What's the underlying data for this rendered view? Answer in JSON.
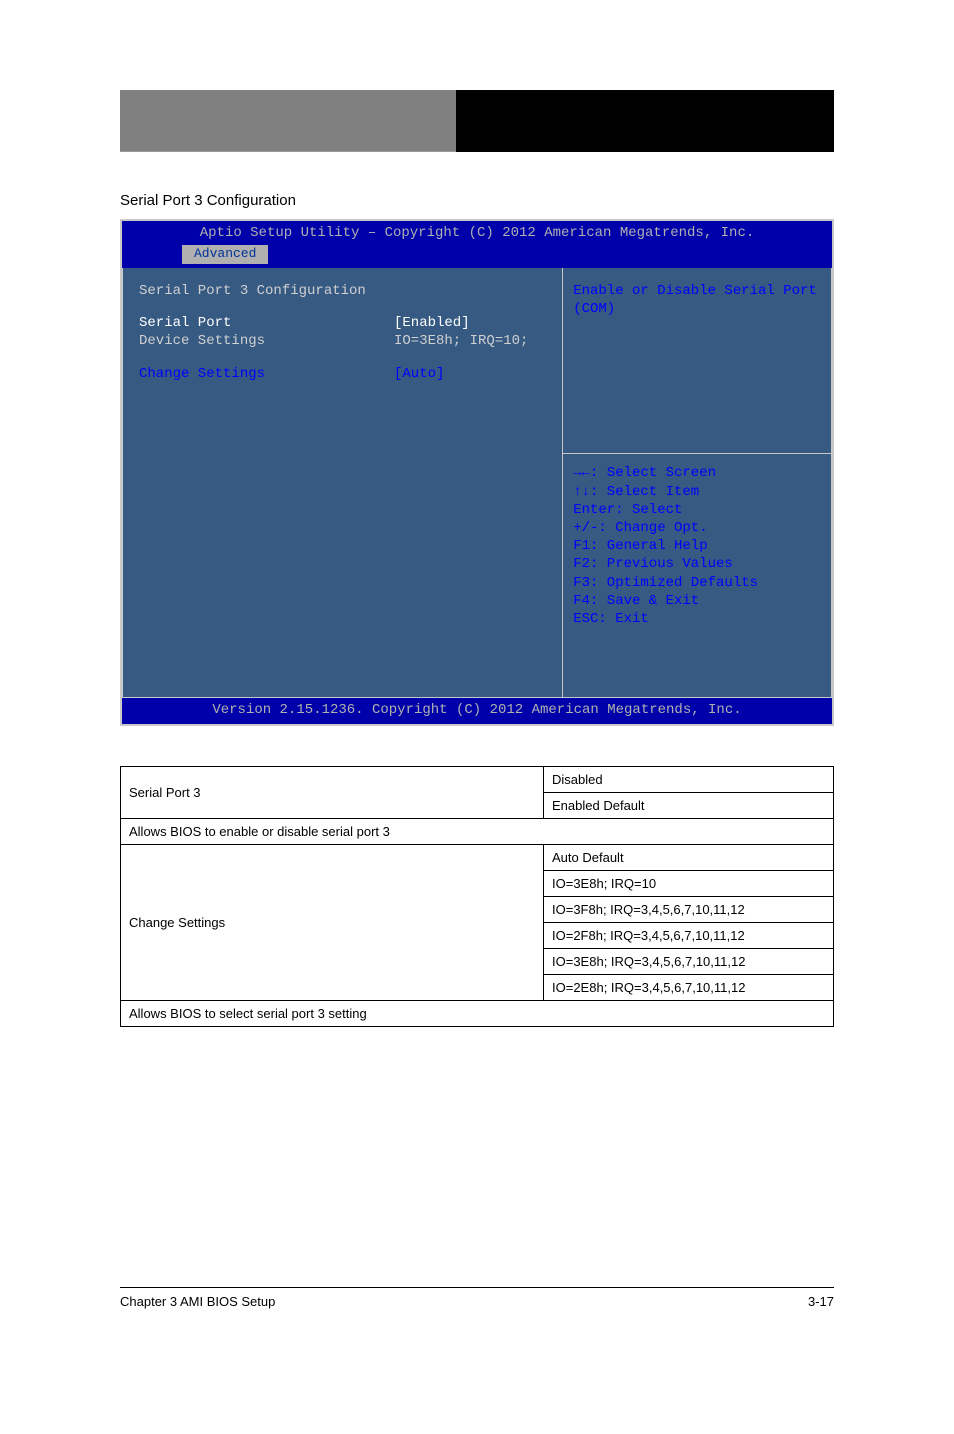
{
  "banner": {
    "right": ""
  },
  "section_label": "Serial Port 3 Configuration",
  "bios": {
    "header": "Aptio Setup Utility – Copyright (C) 2012 American Megatrends, Inc.",
    "tab_active": "Advanced",
    "title": "Serial Port 3 Configuration",
    "rows": [
      {
        "label": "Serial Port",
        "value": "[Enabled]",
        "selected": true
      },
      {
        "label": "Device Settings",
        "value": "IO=3E8h; IRQ=10;",
        "selected": false
      }
    ],
    "link_row": {
      "label": "Change Settings",
      "value": "[Auto]"
    },
    "desc": "Enable or Disable Serial Port (COM)",
    "legend": [
      "→←: Select Screen",
      "↑↓: Select Item",
      "Enter: Select",
      "+/-: Change Opt.",
      "F1: General Help",
      "F2: Previous Values",
      "F3: Optimized Defaults",
      "F4: Save & Exit",
      "ESC: Exit"
    ],
    "footer": "Version 2.15.1236. Copyright (C) 2012 American Megatrends, Inc."
  },
  "opts": {
    "row1": {
      "label": "Serial Port 3",
      "vals": [
        "Disabled",
        "Enabled    Default"
      ]
    },
    "note": "Allows BIOS to enable or disable serial port 3",
    "row2": {
      "label": "Change Settings",
      "vals": [
        "Auto    Default",
        "IO=3E8h; IRQ=10",
        "IO=3F8h; IRQ=3,4,5,6,7,10,11,12",
        "IO=2F8h; IRQ=3,4,5,6,7,10,11,12",
        "IO=3E8h; IRQ=3,4,5,6,7,10,11,12",
        "IO=2E8h; IRQ=3,4,5,6,7,10,11,12"
      ]
    },
    "note2": "Allows BIOS to select serial port 3 setting"
  },
  "footer": {
    "left": "Chapter 3 AMI BIOS Setup",
    "right": "3-17"
  }
}
